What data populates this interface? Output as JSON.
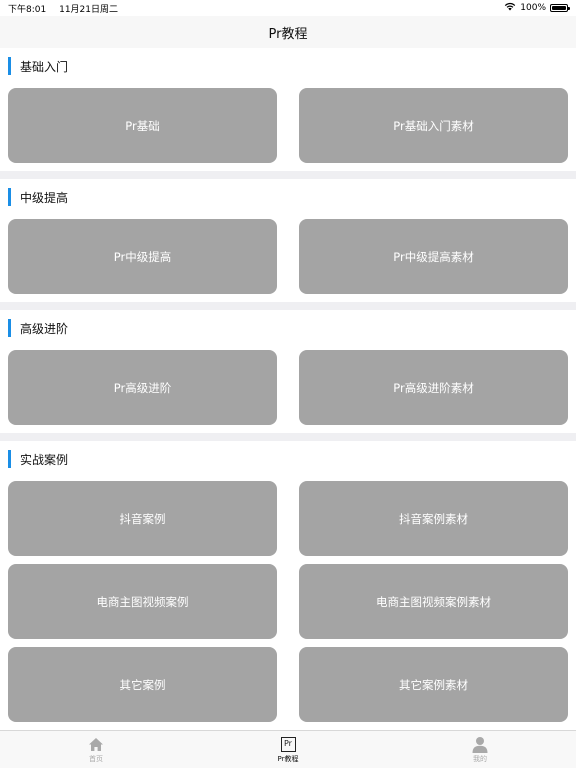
{
  "status_bar": {
    "time": "下午8:01",
    "date": "11月21日周二",
    "battery_text": "100%",
    "battery_level": 1.0
  },
  "nav": {
    "title": "Pr教程"
  },
  "sections": [
    {
      "title": "基础入门",
      "tiles": [
        "Pr基础",
        "Pr基础入门素材"
      ]
    },
    {
      "title": "中级提高",
      "tiles": [
        "Pr中级提高",
        "Pr中级提高素材"
      ]
    },
    {
      "title": "高级进阶",
      "tiles": [
        "Pr高级进阶",
        "Pr高级进阶素材"
      ]
    },
    {
      "title": "实战案例",
      "tiles": [
        "抖音案例",
        "抖音案例素材",
        "电商主图视频案例",
        "电商主图视频案例素材",
        "其它案例",
        "其它案例素材"
      ]
    }
  ],
  "tab_bar": {
    "tabs": [
      {
        "label": "首页",
        "icon": "home-icon",
        "active": false
      },
      {
        "label": "Pr教程",
        "icon": "pr-icon",
        "active": true,
        "icon_text": "Pr"
      },
      {
        "label": "我的",
        "icon": "user-icon",
        "active": false
      }
    ]
  },
  "colors": {
    "accent": "#1a8ee6",
    "tile": "#a4a4a4",
    "section_gap": "#efeff2"
  }
}
